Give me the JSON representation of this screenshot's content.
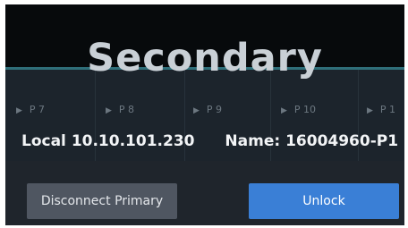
{
  "header": {
    "title": "Secondary"
  },
  "tracks": [
    {
      "label": "P 7",
      "play_icon": "play-triangle-icon"
    },
    {
      "label": "P 8",
      "play_icon": "play-triangle-icon"
    },
    {
      "label": "P 9",
      "play_icon": "play-triangle-icon"
    },
    {
      "label": "P 10",
      "play_icon": "play-triangle-icon"
    },
    {
      "label": "P 1",
      "play_icon": "play-triangle-icon"
    }
  ],
  "connection": {
    "local_label": "Local",
    "local_ip": "10.10.101.230",
    "name_label": "Name:",
    "name_value": "16004960-P1"
  },
  "buttons": {
    "disconnect_label": "Disconnect",
    "primary_label": "Primary",
    "unlock_label": "Unlock"
  },
  "colors": {
    "accent": "#3a7fd6",
    "title": "#c9d0d6",
    "button_secondary": "#4f5661"
  }
}
